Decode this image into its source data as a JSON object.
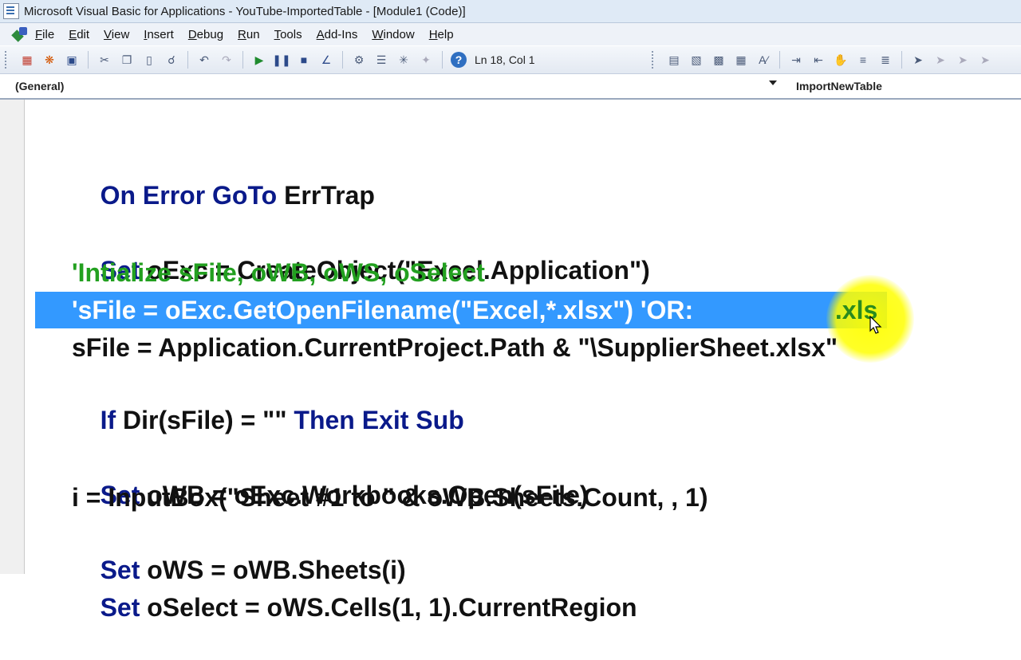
{
  "window": {
    "title": "Microsoft Visual Basic for Applications - YouTube-ImportedTable - [Module1 (Code)]"
  },
  "menu": [
    "File",
    "Edit",
    "View",
    "Insert",
    "Debug",
    "Run",
    "Tools",
    "Add-Ins",
    "Window",
    "Help"
  ],
  "toolbar": {
    "cursor_position": "Ln 18, Col 1"
  },
  "combos": {
    "object": "(General)",
    "procedure": "ImportNewTable"
  },
  "code": {
    "line1_kw": "On Error GoTo",
    "line1_rest": " ErrTrap",
    "line2_kw": "Set",
    "line2_rest": " oExc = CreateObject(\"Excel.Application\")",
    "line3_comment": "'Intialize sFile, oWB, oWS, oSelect",
    "line4_selected": "'sFile = oExc.GetOpenFilename(\"Excel,*.xlsx\") 'OR:",
    "line4_highlight": " .xls",
    "line5": "sFile = Application.CurrentProject.Path & \"\\SupplierSheet.xlsx\"",
    "line6_kw1": "If",
    "line6_mid": " Dir(sFile) = \"\" ",
    "line6_kw2": "Then Exit Sub",
    "line7_kw": "Set",
    "line7_rest": " oWB = oExc.Workbooks.Open(sFile)",
    "line8": "i = InputBox(\"Sheet #1 to \" & oWB.Sheets.Count, , 1)",
    "line9_kw": "Set",
    "line9_rest": " oWS = oWB.Sheets(i)",
    "line10_kw": "Set",
    "line10_rest": " oSelect = oWS.Cells(1, 1).CurrentRegion"
  }
}
